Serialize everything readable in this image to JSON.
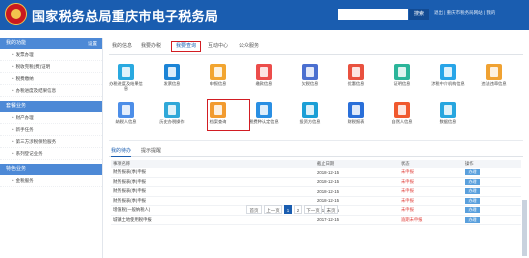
{
  "header": {
    "title": "国家税务总局重庆市电子税务局",
    "search_button": "搜索",
    "links": "退出 | 重庆市税务局网站 | 我的"
  },
  "sidebar": {
    "sections": [
      {
        "title": "我的功能",
        "more": "设置",
        "items": [
          "发票办理",
          "税收完税(费)证明",
          "税费缴纳",
          "办税进度及结果信息"
        ]
      },
      {
        "title": "套餐业务",
        "items": [
          "财产办理",
          "新手任务",
          "第三方涉税保险服务",
          "系列登记业务"
        ]
      },
      {
        "title": "特色业务",
        "items": [
          "金税服务"
        ]
      }
    ]
  },
  "main": {
    "tabs": [
      "我的信息",
      "我要办税",
      "我要查询",
      "互动中心",
      "公众服务"
    ],
    "icons": [
      {
        "label": "办税进度及结果信息",
        "color": "#29a9e0"
      },
      {
        "label": "发票信息",
        "color": "#1b84d6"
      },
      {
        "label": "申报信息",
        "color": "#f2a530"
      },
      {
        "label": "缴款信息",
        "color": "#ec4d4b"
      },
      {
        "label": "欠税信息",
        "color": "#4a6fd0"
      },
      {
        "label": "优惠信息",
        "color": "#e9513f"
      },
      {
        "label": "证明信息",
        "color": "#2bb59a"
      },
      {
        "label": "涉税中介机构信息",
        "color": "#28a5e8"
      },
      {
        "label": "违法违章信息",
        "color": "#f0a232"
      },
      {
        "label": "纳税人信息",
        "color": "#4d8ee8"
      },
      {
        "label": "历史办税操作",
        "color": "#30a8d8"
      },
      {
        "label": "档案查询",
        "color": "#f29b2f"
      },
      {
        "label": "税费种认定信息",
        "color": "#2a8fe3"
      },
      {
        "label": "投资方信息",
        "color": "#1b9fd6"
      },
      {
        "label": "财税报表",
        "color": "#2a6fd9"
      },
      {
        "label": "自然人信息",
        "color": "#f0592e"
      },
      {
        "label": "数据信息",
        "color": "#27a6df"
      }
    ],
    "panel_tabs": [
      "我的待办",
      "提示提醒"
    ],
    "table": {
      "headers": [
        "事项名称",
        "截止日期",
        "状态",
        "操作"
      ],
      "rows": [
        {
          "name": "财务报表(季)申报",
          "date": "2018-12-15",
          "status": "未申报",
          "op": "办理"
        },
        {
          "name": "财务报表(季)申报",
          "date": "2018-12-15",
          "status": "未申报",
          "op": "办理"
        },
        {
          "name": "财务报表(季)申报",
          "date": "2018-12-15",
          "status": "未申报",
          "op": "办理"
        },
        {
          "name": "财务报表(季)申报",
          "date": "2018-12-15",
          "status": "未申报",
          "op": "办理"
        },
        {
          "name": "增值税(一般纳税人)",
          "date": "2018-12-15",
          "status": "未申报",
          "op": "办理"
        },
        {
          "name": "城镇土地使用税申报",
          "date": "2017-12-15",
          "status": "逾期未申报",
          "op": "办理"
        }
      ]
    },
    "pager": [
      "首页",
      "上一页",
      "1",
      "2",
      "下一页",
      "末页"
    ]
  }
}
